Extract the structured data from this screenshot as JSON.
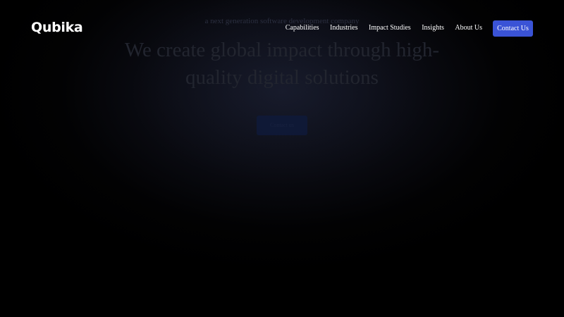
{
  "header": {
    "logo": "Qubika",
    "nav": [
      "Capabilities",
      "Industries",
      "Impact Studies",
      "Insights",
      "About Us"
    ],
    "contact_label": "Contact Us"
  },
  "hero": {
    "eyebrow": "a next generation software development company",
    "title": "We create global impact through high-quality digital solutions",
    "cta_label": "Contact us"
  },
  "colors": {
    "background": "#000000",
    "accent": "#3a53d6",
    "nav_text": "#ffffff"
  }
}
